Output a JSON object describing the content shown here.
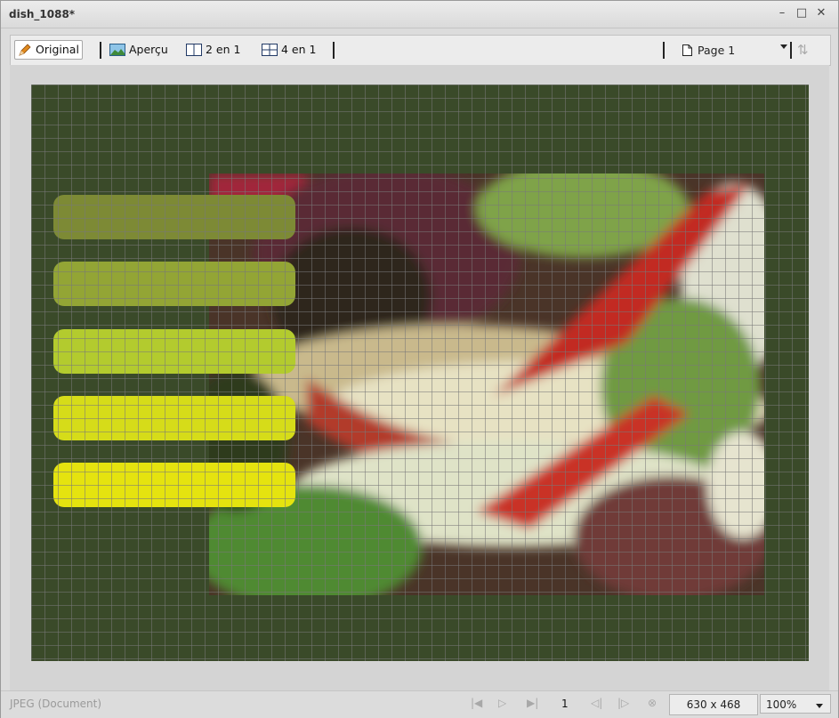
{
  "window": {
    "title": "dish_1088*"
  },
  "controls": {
    "minimize": "–",
    "maximize": "□",
    "close": "✕"
  },
  "toolbar": {
    "original_label": "Original",
    "apercu_label": "Aperçu",
    "two_in_one_label": "2 en 1",
    "four_in_one_label": "4 en 1",
    "page_label": "Page 1"
  },
  "bars": {
    "colors": [
      "#7d8a35",
      "#93a535",
      "#b3cb2e",
      "#d6dc19",
      "#e5e30f"
    ]
  },
  "status": {
    "file_type": "JPEG (Document)",
    "page_number": "1",
    "dimensions": "630 x 468",
    "zoom": "100%"
  },
  "icons": {
    "pencil": "pencil-icon",
    "preview": "image-preview-icon",
    "two_in_one": "split-two-icon",
    "four_in_one": "split-four-icon",
    "page": "page-icon",
    "sort": "sort-icon"
  }
}
